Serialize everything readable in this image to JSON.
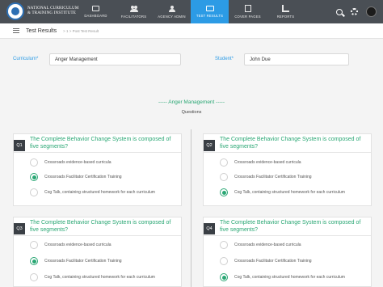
{
  "brand": {
    "line1": "NATIONAL CURRICULUM",
    "line2": "& TRAINING INSTITUTE"
  },
  "nav": [
    {
      "label": "DASHBOARD",
      "icon": "dashboard-icon",
      "active": false
    },
    {
      "label": "FACILITATORS",
      "icon": "people-icon",
      "active": false
    },
    {
      "label": "AGENCY ADMIN",
      "icon": "admin-icon",
      "active": false
    },
    {
      "label": "TEST RESULTS",
      "icon": "monitor-icon",
      "active": true
    },
    {
      "label": "COVER PAGES",
      "icon": "document-icon",
      "active": false
    },
    {
      "label": "REPORTS",
      "icon": "report-icon",
      "active": false
    }
  ],
  "header": {
    "title": "Test Results",
    "breadcrumb": "> 1 > Post Test Result"
  },
  "filters": {
    "curriculum_label": "Curriculum*",
    "curriculum_value": "Anger Management",
    "student_label": "Student*",
    "student_value": "John Due"
  },
  "section": {
    "title": "Anger Management",
    "subtitle": "Questions"
  },
  "colors": {
    "accent_blue": "#2c9be5",
    "accent_green": "#2aa774",
    "topbar": "#4a4f55"
  },
  "questions": [
    {
      "number": "Q1",
      "text": "The Complete Behavior Change System is composed of five segments?",
      "options": [
        {
          "label": "Crossroads evidence-based curricula",
          "selected": false
        },
        {
          "label": "Crossroads Facilitator Certification Training",
          "selected": true
        },
        {
          "label": "Cog Talk, containing structured homework for each curriculum",
          "selected": false
        }
      ]
    },
    {
      "number": "Q2",
      "text": "The Complete Behavior Change System is composed of five segments?",
      "options": [
        {
          "label": "Crossroads evidence-based curricula",
          "selected": false
        },
        {
          "label": "Crossroads Facilitator Certification Training",
          "selected": false
        },
        {
          "label": "Cog Talk, containing structured homework for each curriculum",
          "selected": true
        }
      ]
    },
    {
      "number": "Q3",
      "text": "The Complete Behavior Change System is composed of five segments?",
      "options": [
        {
          "label": "Crossroads evidence-based curricula",
          "selected": false
        },
        {
          "label": "Crossroads Facilitator Certification Training",
          "selected": true
        },
        {
          "label": "Cog Talk, containing structured homework for each curriculum",
          "selected": false
        }
      ]
    },
    {
      "number": "Q4",
      "text": "The Complete Behavior Change System is composed of five segments?",
      "options": [
        {
          "label": "Crossroads evidence-based curricula",
          "selected": false
        },
        {
          "label": "Crossroads Facilitator Certification Training",
          "selected": false
        },
        {
          "label": "Cog Talk, containing structured homework for each curriculum",
          "selected": true
        }
      ]
    }
  ]
}
